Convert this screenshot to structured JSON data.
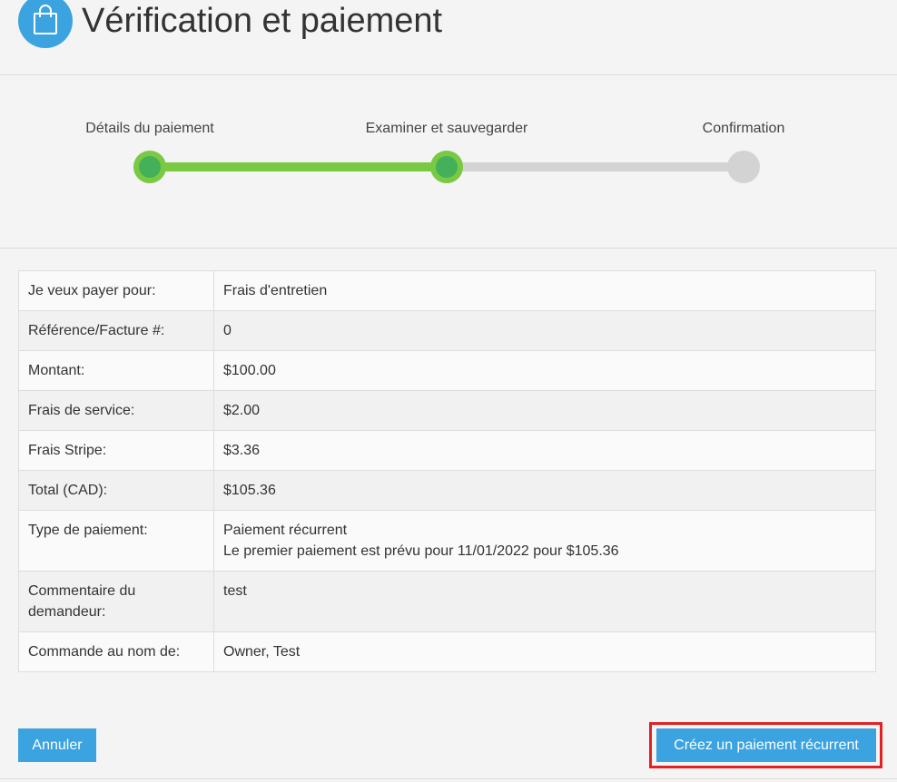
{
  "header": {
    "title": "Vérification et paiement",
    "icon": "shopping-bag-icon",
    "accent_color": "#3aa3e0"
  },
  "stepper": {
    "steps": [
      {
        "label": "Détails du paiement",
        "state": "done"
      },
      {
        "label": "Examiner et sauvegarder",
        "state": "done"
      },
      {
        "label": "Confirmation",
        "state": "todo"
      }
    ],
    "done_color": "#7ac943",
    "todo_color": "#d3d3d3"
  },
  "summary": {
    "rows": [
      {
        "label": "Je veux payer pour:",
        "value": "Frais d'entretien"
      },
      {
        "label": "Référence/Facture #:",
        "value": "0"
      },
      {
        "label": "Montant:",
        "value": "$100.00"
      },
      {
        "label": "Frais de service:",
        "value": "$2.00"
      },
      {
        "label": "Frais Stripe:",
        "value": "$3.36"
      },
      {
        "label": "Total (CAD):",
        "value": "$105.36"
      },
      {
        "label": "Type de paiement:",
        "value": "Paiement récurrent",
        "value2": "Le premier paiement est prévu pour 11/01/2022 pour $105.36"
      },
      {
        "label": "Commentaire du demandeur:",
        "value": "test"
      },
      {
        "label": "Commande au nom de:",
        "value": "Owner, Test"
      }
    ]
  },
  "actions": {
    "cancel_label": "Annuler",
    "submit_label": "Créez un paiement récurrent",
    "highlight_color": "#e32125"
  }
}
